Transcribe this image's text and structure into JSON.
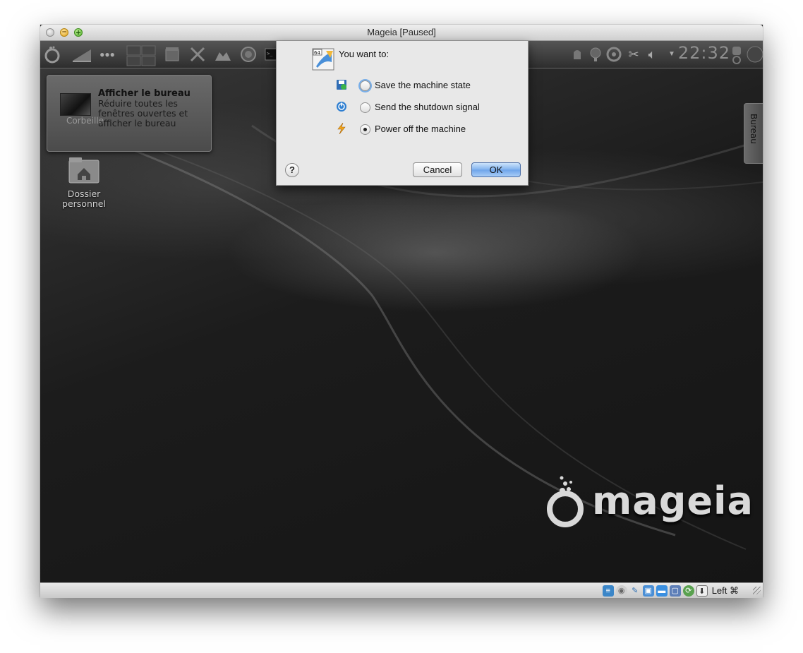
{
  "window": {
    "title": "Mageia [Paused]"
  },
  "guest": {
    "clock": "22:32",
    "tooltip": {
      "title": "Afficher le bureau",
      "body": "Réduire toutes les fenêtres ouvertes et afficher le bureau",
      "under_label": "Corbeille"
    },
    "desktop_icons": [
      {
        "label": "Dossier personnel",
        "icon": "home-folder-icon"
      }
    ],
    "right_tab": "Bureau",
    "logo_text": "mageia"
  },
  "dialog": {
    "prompt": "You want to:",
    "options": [
      {
        "label": "Save the machine state",
        "icon": "save-state-icon",
        "checked": false,
        "focused": true
      },
      {
        "label": "Send the shutdown signal",
        "icon": "power-button-icon",
        "checked": false,
        "focused": false
      },
      {
        "label": "Power off the machine",
        "icon": "lightning-icon",
        "checked": true,
        "focused": false
      }
    ],
    "help_label": "?",
    "cancel_label": "Cancel",
    "ok_label": "OK"
  },
  "statusbar": {
    "host_key": "Left ⌘",
    "icons": [
      "hard-disk-icon",
      "optical-drive-icon",
      "usb-icon",
      "network-icon",
      "shared-folder-icon",
      "display-icon",
      "virtualization-icon",
      "mouse-integration-icon"
    ]
  },
  "colors": {
    "ok_button": "#7fb1ee",
    "sheet_bg": "#e8e8e8",
    "desktop_bg": "#1c1c1c"
  }
}
